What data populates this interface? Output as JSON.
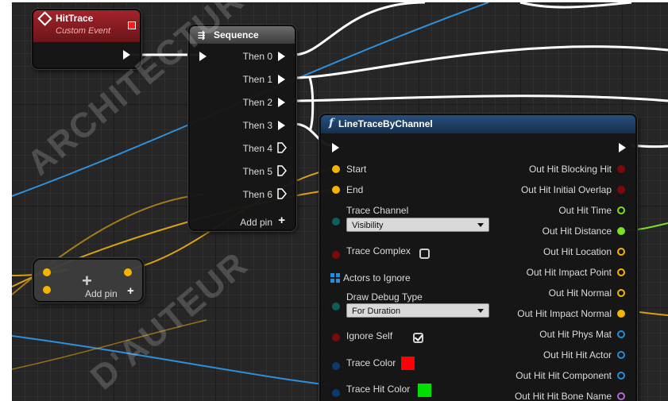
{
  "event_node": {
    "title": "HitTrace",
    "subtitle": "Custom Event",
    "title_icon": "diamond-event-icon",
    "header_color": "#a4232b"
  },
  "sequence_node": {
    "title": "Sequence",
    "title_icon": "sequence-icon",
    "outputs": [
      "Then 0",
      "Then 1",
      "Then 2",
      "Then 3",
      "Then 4",
      "Then 5",
      "Then 6"
    ],
    "add_pin": "Add pin"
  },
  "add_node": {
    "add_pin": "Add pin"
  },
  "linetrace_node": {
    "title": "LineTraceByChannel",
    "title_icon": "function-f-icon",
    "header_color": "#274f7c",
    "inputs": {
      "start": "Start",
      "end": "End",
      "trace_channel": "Trace Channel",
      "trace_channel_value": "Visibility",
      "trace_complex": "Trace Complex",
      "actors_to_ignore": "Actors to Ignore",
      "draw_debug_type": "Draw Debug Type",
      "draw_debug_type_value": "For Duration",
      "ignore_self": "Ignore Self",
      "trace_color": "Trace Color",
      "trace_hit_color": "Trace Hit Color"
    },
    "trace_complex_checked": false,
    "ignore_self_checked": true,
    "trace_color_value": "#ff0000",
    "trace_hit_color_value": "#00e000",
    "outputs": [
      "Out Hit Blocking Hit",
      "Out Hit Initial Overlap",
      "Out Hit Time",
      "Out Hit Distance",
      "Out Hit Location",
      "Out Hit Impact Point",
      "Out Hit Normal",
      "Out Hit Impact Normal",
      "Out Hit Phys Mat",
      "Out Hit Hit Actor",
      "Out Hit Hit Component",
      "Out Hit Hit Bone Name"
    ]
  },
  "colors": {
    "exec": "#ffffff",
    "vector": "#f4b400",
    "bool": "#8b0000",
    "float": "#7be01f",
    "object": "#1f8fe0",
    "name": "#b066e0",
    "byte": "#0f6e6a"
  },
  "watermark": {
    "line1": "ARCHITECTURE DE FANTES",
    "line2": "D'AUTEUR"
  }
}
